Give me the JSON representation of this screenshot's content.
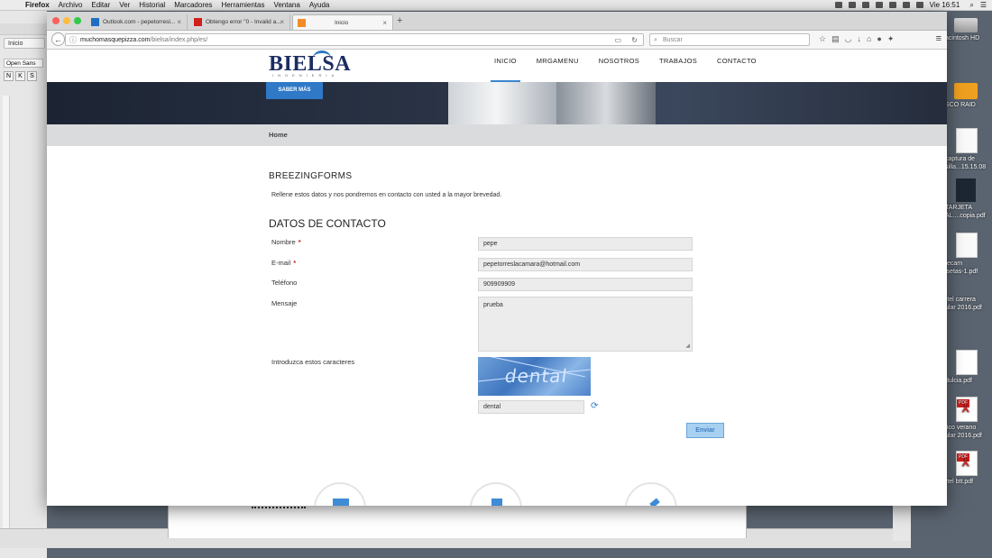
{
  "menubar": {
    "app": "Firefox",
    "items": [
      "Archivo",
      "Editar",
      "Ver",
      "Historial",
      "Marcadores",
      "Herramientas",
      "Ventana",
      "Ayuda"
    ],
    "clock": "Vie 16:51"
  },
  "bgapp": {
    "tab_label": "Inicio",
    "font_name": "Open Sans",
    "format_buttons": [
      "N",
      "K",
      "S"
    ]
  },
  "desktop": {
    "icons": [
      "acintosh HD",
      "SCO RAID",
      "captura de\nsilla...15.15.08",
      "TARJETA\nAL....copia.pdf",
      "fecam\nisetas-1.pdf",
      "rtel carrera\nular 2016.pdf",
      "dulcia.pdf",
      "tico verano\nular 2016.pdf",
      "rtel btt.pdf"
    ]
  },
  "browser": {
    "tabs": [
      {
        "label": "Outlook.com - pepetorresl...",
        "active": false
      },
      {
        "label": "Obtengo error \"0 - Invalid a...",
        "active": false
      },
      {
        "label": "Inicio",
        "active": true
      }
    ],
    "url_domain": "muchomasquepizza.com",
    "url_path": "/bielsa/index.php/es/",
    "search_placeholder": "Buscar"
  },
  "site": {
    "logo_text": "BIELSA",
    "logo_sub": "INGENIERIA",
    "nav": [
      "INICIO",
      "MRGAMENU",
      "NOSOTROS",
      "TRABAJOS",
      "CONTACTO"
    ],
    "hero_button": "SABER MÁS",
    "breadcrumb": "Home",
    "form_title": "BREEZINGFORMS",
    "form_intro": "Rellene estos datos y nos pondremos en contacto con usted a la mayor brevedad.",
    "section_title": "DATOS DE CONTACTO",
    "fields": {
      "nombre_label": "Nombre",
      "nombre_value": "pepe",
      "email_label": "E-mail",
      "email_value": "pepetorreslacamara@hotmail.com",
      "telefono_label": "Teléfono",
      "telefono_value": "909909909",
      "mensaje_label": "Mensaje",
      "mensaje_value": "prueba",
      "captcha_label": "Introduzca estos caracteres",
      "captcha_image_text": "dental",
      "captcha_value": "dental"
    },
    "required_mark": "*",
    "submit_label": "Enviar"
  },
  "colors": {
    "accent": "#2f79c7",
    "brand": "#1c2d63",
    "required": "#d0201c"
  }
}
